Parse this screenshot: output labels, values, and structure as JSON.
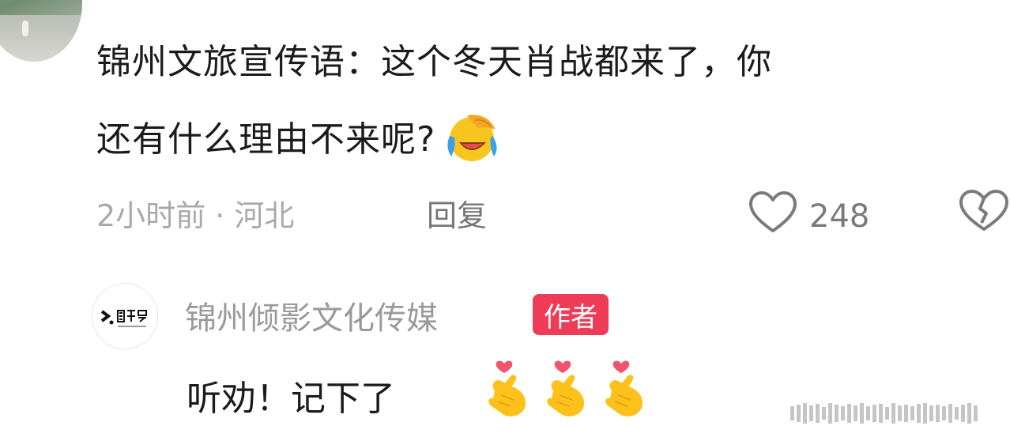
{
  "comment": {
    "line1": "锦州文旅宣传语：这个冬天肖战都来了，你",
    "line2": "还有什么理由不来呢?",
    "emoji": "laughing-crying-emoji",
    "time_location": "2小时前 · 河北",
    "reply_label": "回复",
    "like_count": "248"
  },
  "author_reply": {
    "name": "锦州倾影文化传媒",
    "badge": "作者",
    "text": "听劝！记下了",
    "emojis": [
      "finger-heart-emoji",
      "finger-heart-emoji",
      "finger-heart-emoji"
    ]
  },
  "colors": {
    "badge": "#ee3b57",
    "meta_text": "#a9a9a9",
    "body_text": "#1b1b1b"
  }
}
